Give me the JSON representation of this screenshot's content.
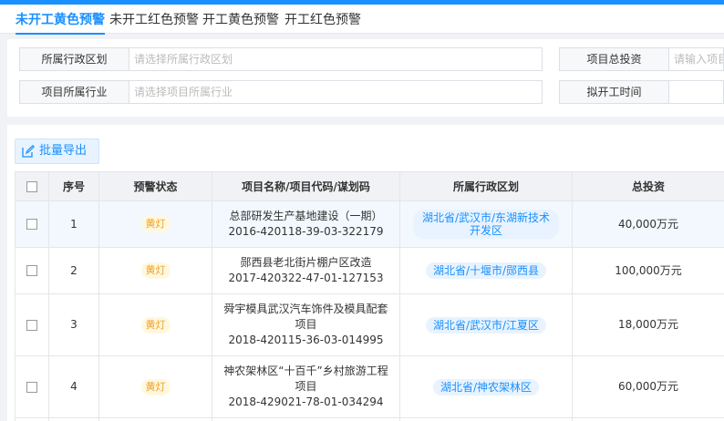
{
  "tabs": [
    {
      "label": "未开工黄色预警"
    },
    {
      "label": "未开工红色预警"
    },
    {
      "label": "开工黄色预警"
    },
    {
      "label": "开工红色预警"
    }
  ],
  "filters": {
    "region_label": "所属行政区划",
    "region_placeholder": "请选择所属行政区划",
    "industry_label": "项目所属行业",
    "industry_placeholder": "请选择项目所属行业",
    "investment_label": "项目总投资",
    "investment_placeholder": "请输入项目",
    "start_time_label": "拟开工时间",
    "start_time_placeholder": ""
  },
  "toolbar": {
    "export_label": "批量导出"
  },
  "table": {
    "headers": [
      "序号",
      "预警状态",
      "项目名称/项目代码/谋划码",
      "所属行政区划",
      "总投资"
    ],
    "rows": [
      {
        "index": "1",
        "status": "黄灯",
        "name": "总部研发生产基地建设（一期）",
        "code": "2016-420118-39-03-322179",
        "region": "湖北省/武汉市/东湖新技术开发区",
        "investment": "40,000万元"
      },
      {
        "index": "2",
        "status": "黄灯",
        "name": "郧西县老北街片棚户区改造",
        "code": "2017-420322-47-01-127153",
        "region": "湖北省/十堰市/郧西县",
        "investment": "100,000万元"
      },
      {
        "index": "3",
        "status": "黄灯",
        "name": "舜宇模具武汉汽车饰件及模具配套项目",
        "code": "2018-420115-36-03-014995",
        "region": "湖北省/武汉市/江夏区",
        "investment": "18,000万元"
      },
      {
        "index": "4",
        "status": "黄灯",
        "name": "神农架林区“十百千”乡村旅游工程项目",
        "code": "2018-429021-78-01-034294",
        "region": "湖北省/神农架林区",
        "investment": "60,000万元"
      }
    ]
  },
  "colors": {
    "accent": "#1890ff",
    "badge_bg": "#fff8e1",
    "badge_text": "#f0a020"
  }
}
